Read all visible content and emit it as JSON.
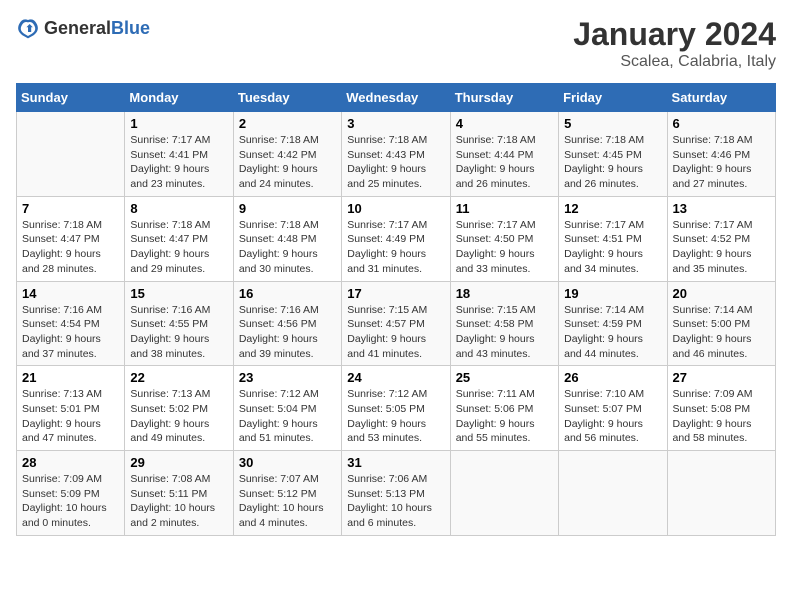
{
  "header": {
    "logo_general": "General",
    "logo_blue": "Blue",
    "title": "January 2024",
    "subtitle": "Scalea, Calabria, Italy"
  },
  "columns": [
    "Sunday",
    "Monday",
    "Tuesday",
    "Wednesday",
    "Thursday",
    "Friday",
    "Saturday"
  ],
  "weeks": [
    [
      {
        "day": "",
        "sunrise": "",
        "sunset": "",
        "daylight": ""
      },
      {
        "day": "1",
        "sunrise": "Sunrise: 7:17 AM",
        "sunset": "Sunset: 4:41 PM",
        "daylight": "Daylight: 9 hours and 23 minutes."
      },
      {
        "day": "2",
        "sunrise": "Sunrise: 7:18 AM",
        "sunset": "Sunset: 4:42 PM",
        "daylight": "Daylight: 9 hours and 24 minutes."
      },
      {
        "day": "3",
        "sunrise": "Sunrise: 7:18 AM",
        "sunset": "Sunset: 4:43 PM",
        "daylight": "Daylight: 9 hours and 25 minutes."
      },
      {
        "day": "4",
        "sunrise": "Sunrise: 7:18 AM",
        "sunset": "Sunset: 4:44 PM",
        "daylight": "Daylight: 9 hours and 26 minutes."
      },
      {
        "day": "5",
        "sunrise": "Sunrise: 7:18 AM",
        "sunset": "Sunset: 4:45 PM",
        "daylight": "Daylight: 9 hours and 26 minutes."
      },
      {
        "day": "6",
        "sunrise": "Sunrise: 7:18 AM",
        "sunset": "Sunset: 4:46 PM",
        "daylight": "Daylight: 9 hours and 27 minutes."
      }
    ],
    [
      {
        "day": "7",
        "sunrise": "Sunrise: 7:18 AM",
        "sunset": "Sunset: 4:47 PM",
        "daylight": "Daylight: 9 hours and 28 minutes."
      },
      {
        "day": "8",
        "sunrise": "Sunrise: 7:18 AM",
        "sunset": "Sunset: 4:47 PM",
        "daylight": "Daylight: 9 hours and 29 minutes."
      },
      {
        "day": "9",
        "sunrise": "Sunrise: 7:18 AM",
        "sunset": "Sunset: 4:48 PM",
        "daylight": "Daylight: 9 hours and 30 minutes."
      },
      {
        "day": "10",
        "sunrise": "Sunrise: 7:17 AM",
        "sunset": "Sunset: 4:49 PM",
        "daylight": "Daylight: 9 hours and 31 minutes."
      },
      {
        "day": "11",
        "sunrise": "Sunrise: 7:17 AM",
        "sunset": "Sunset: 4:50 PM",
        "daylight": "Daylight: 9 hours and 33 minutes."
      },
      {
        "day": "12",
        "sunrise": "Sunrise: 7:17 AM",
        "sunset": "Sunset: 4:51 PM",
        "daylight": "Daylight: 9 hours and 34 minutes."
      },
      {
        "day": "13",
        "sunrise": "Sunrise: 7:17 AM",
        "sunset": "Sunset: 4:52 PM",
        "daylight": "Daylight: 9 hours and 35 minutes."
      }
    ],
    [
      {
        "day": "14",
        "sunrise": "Sunrise: 7:16 AM",
        "sunset": "Sunset: 4:54 PM",
        "daylight": "Daylight: 9 hours and 37 minutes."
      },
      {
        "day": "15",
        "sunrise": "Sunrise: 7:16 AM",
        "sunset": "Sunset: 4:55 PM",
        "daylight": "Daylight: 9 hours and 38 minutes."
      },
      {
        "day": "16",
        "sunrise": "Sunrise: 7:16 AM",
        "sunset": "Sunset: 4:56 PM",
        "daylight": "Daylight: 9 hours and 39 minutes."
      },
      {
        "day": "17",
        "sunrise": "Sunrise: 7:15 AM",
        "sunset": "Sunset: 4:57 PM",
        "daylight": "Daylight: 9 hours and 41 minutes."
      },
      {
        "day": "18",
        "sunrise": "Sunrise: 7:15 AM",
        "sunset": "Sunset: 4:58 PM",
        "daylight": "Daylight: 9 hours and 43 minutes."
      },
      {
        "day": "19",
        "sunrise": "Sunrise: 7:14 AM",
        "sunset": "Sunset: 4:59 PM",
        "daylight": "Daylight: 9 hours and 44 minutes."
      },
      {
        "day": "20",
        "sunrise": "Sunrise: 7:14 AM",
        "sunset": "Sunset: 5:00 PM",
        "daylight": "Daylight: 9 hours and 46 minutes."
      }
    ],
    [
      {
        "day": "21",
        "sunrise": "Sunrise: 7:13 AM",
        "sunset": "Sunset: 5:01 PM",
        "daylight": "Daylight: 9 hours and 47 minutes."
      },
      {
        "day": "22",
        "sunrise": "Sunrise: 7:13 AM",
        "sunset": "Sunset: 5:02 PM",
        "daylight": "Daylight: 9 hours and 49 minutes."
      },
      {
        "day": "23",
        "sunrise": "Sunrise: 7:12 AM",
        "sunset": "Sunset: 5:04 PM",
        "daylight": "Daylight: 9 hours and 51 minutes."
      },
      {
        "day": "24",
        "sunrise": "Sunrise: 7:12 AM",
        "sunset": "Sunset: 5:05 PM",
        "daylight": "Daylight: 9 hours and 53 minutes."
      },
      {
        "day": "25",
        "sunrise": "Sunrise: 7:11 AM",
        "sunset": "Sunset: 5:06 PM",
        "daylight": "Daylight: 9 hours and 55 minutes."
      },
      {
        "day": "26",
        "sunrise": "Sunrise: 7:10 AM",
        "sunset": "Sunset: 5:07 PM",
        "daylight": "Daylight: 9 hours and 56 minutes."
      },
      {
        "day": "27",
        "sunrise": "Sunrise: 7:09 AM",
        "sunset": "Sunset: 5:08 PM",
        "daylight": "Daylight: 9 hours and 58 minutes."
      }
    ],
    [
      {
        "day": "28",
        "sunrise": "Sunrise: 7:09 AM",
        "sunset": "Sunset: 5:09 PM",
        "daylight": "Daylight: 10 hours and 0 minutes."
      },
      {
        "day": "29",
        "sunrise": "Sunrise: 7:08 AM",
        "sunset": "Sunset: 5:11 PM",
        "daylight": "Daylight: 10 hours and 2 minutes."
      },
      {
        "day": "30",
        "sunrise": "Sunrise: 7:07 AM",
        "sunset": "Sunset: 5:12 PM",
        "daylight": "Daylight: 10 hours and 4 minutes."
      },
      {
        "day": "31",
        "sunrise": "Sunrise: 7:06 AM",
        "sunset": "Sunset: 5:13 PM",
        "daylight": "Daylight: 10 hours and 6 minutes."
      },
      {
        "day": "",
        "sunrise": "",
        "sunset": "",
        "daylight": ""
      },
      {
        "day": "",
        "sunrise": "",
        "sunset": "",
        "daylight": ""
      },
      {
        "day": "",
        "sunrise": "",
        "sunset": "",
        "daylight": ""
      }
    ]
  ]
}
